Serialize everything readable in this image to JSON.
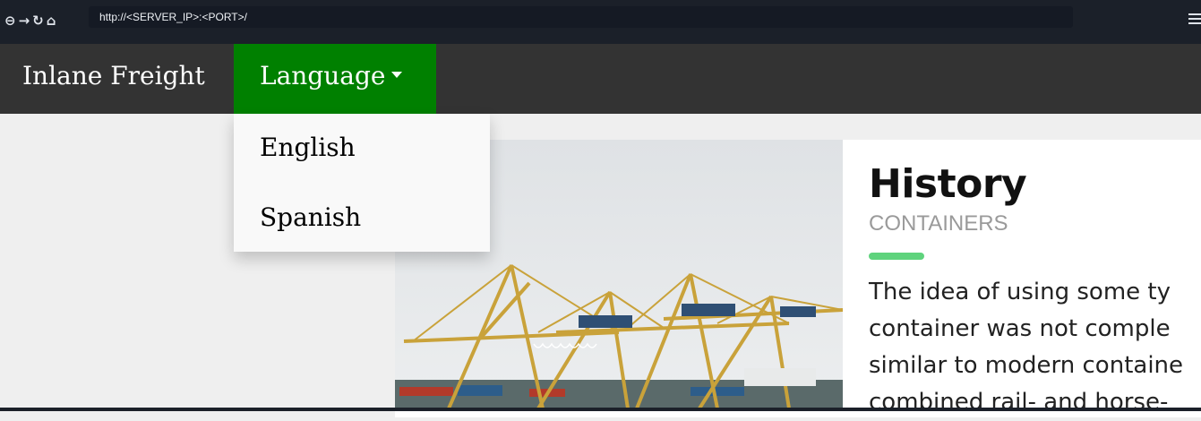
{
  "browser": {
    "url": "http://<SERVER_IP>:<PORT>/",
    "nav_icons": [
      "back-icon",
      "forward-icon",
      "reload-icon",
      "home-icon"
    ],
    "menu_icon": "hamburger-menu-icon"
  },
  "navbar": {
    "brand": "Inlane Freight",
    "language_label": "Language",
    "accent_color": "#008000"
  },
  "dropdown": {
    "items": [
      {
        "label": "English"
      },
      {
        "label": "Spanish"
      }
    ]
  },
  "article": {
    "title": "History",
    "subtitle": "CONTAINERS",
    "accent_bar_color": "#5fd37d",
    "lines": [
      "The idea of using some ty",
      "container was not comple",
      "similar to modern containe",
      "combined rail- and horse-"
    ]
  }
}
